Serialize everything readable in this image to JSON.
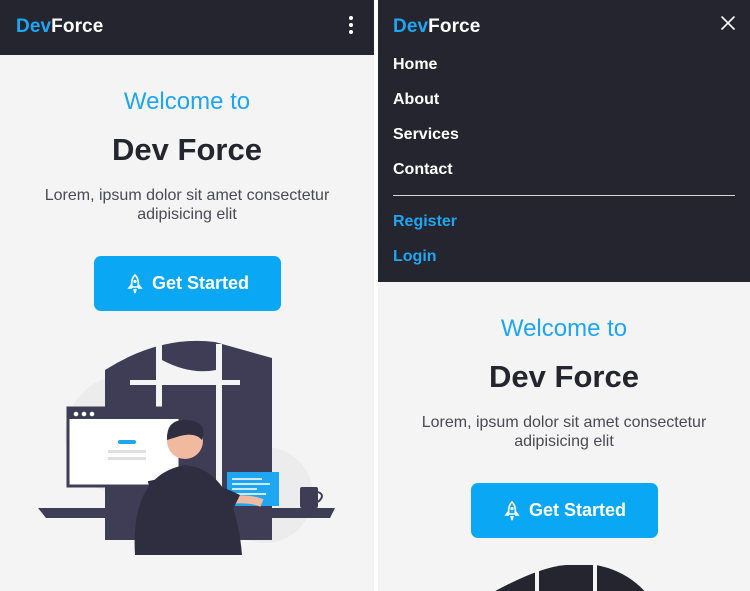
{
  "brand": {
    "part1": "Dev",
    "part2": "Force"
  },
  "menu": {
    "items": [
      {
        "label": "Home"
      },
      {
        "label": "About"
      },
      {
        "label": "Services"
      },
      {
        "label": "Contact"
      }
    ],
    "auth": [
      {
        "label": "Register"
      },
      {
        "label": "Login"
      }
    ]
  },
  "hero": {
    "welcome": "Welcome to",
    "title": "Dev Force",
    "subtitle_line1": "Lorem, ipsum dolor sit amet consectetur",
    "subtitle_line2": "adipisicing elit",
    "cta": "Get Started"
  },
  "icons": {
    "menu": "kebab-menu-icon",
    "close": "close-icon",
    "cta": "rocket-icon"
  },
  "colors": {
    "accent": "#1ea6f3",
    "navbar": "#25252f",
    "background": "#f4f4f4",
    "button": "#0aa8f4"
  }
}
